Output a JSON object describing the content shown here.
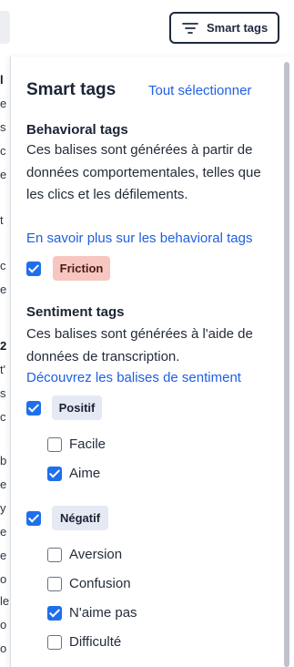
{
  "background": {
    "fragments": [
      {
        "text": "l",
        "bold": true
      },
      {
        "text": "e",
        "bold": false
      },
      {
        "text": "s",
        "bold": false
      },
      {
        "text": "c",
        "bold": false
      },
      {
        "text": "e",
        "bold": false
      },
      {
        "text": "t",
        "bold": false
      },
      {
        "text": "c",
        "bold": false
      },
      {
        "text": "e",
        "bold": false
      },
      {
        "text": "2",
        "bold": true
      },
      {
        "text": "t'",
        "bold": false
      },
      {
        "text": "s",
        "bold": false
      },
      {
        "text": "c",
        "bold": false
      },
      {
        "text": "b",
        "bold": false
      },
      {
        "text": "e",
        "bold": false
      },
      {
        "text": "y",
        "bold": false
      },
      {
        "text": "e",
        "bold": false
      },
      {
        "text": "e",
        "bold": false
      },
      {
        "text": "o",
        "bold": false
      },
      {
        "text": "le",
        "bold": false
      },
      {
        "text": "o",
        "bold": false
      },
      {
        "text": "o",
        "bold": false
      }
    ]
  },
  "toolbar": {
    "smart_tags_button": "Smart tags",
    "smart_tags_icon": "filter-lines-icon"
  },
  "panel": {
    "title": "Smart tags",
    "select_all": "Tout sélectionner",
    "behavioral": {
      "title": "Behavioral tags",
      "description": "Ces balises sont générées à partir de données comportementales, telles que les clics et les défilements.",
      "link": "En savoir plus sur les behavioral tags",
      "tag": {
        "label": "Friction",
        "checked": true,
        "color": "#f8c6c0"
      }
    },
    "sentiment": {
      "title": "Sentiment tags",
      "description": "Ces balises sont générées à l'aide de données de transcription.",
      "link": "Découvrez les balises de sentiment",
      "positive": {
        "label": "Positif",
        "checked": true,
        "items": [
          {
            "label": "Facile",
            "checked": false
          },
          {
            "label": "Aime",
            "checked": true
          }
        ]
      },
      "negative": {
        "label": "Négatif",
        "checked": true,
        "items": [
          {
            "label": "Aversion",
            "checked": false
          },
          {
            "label": "Confusion",
            "checked": false
          },
          {
            "label": "N'aime pas",
            "checked": true
          },
          {
            "label": "Difficulté",
            "checked": false
          }
        ]
      }
    }
  },
  "colors": {
    "accent": "#1f6feb",
    "link": "#1f5fe0",
    "badge_neutral": "#e5e9f3"
  }
}
